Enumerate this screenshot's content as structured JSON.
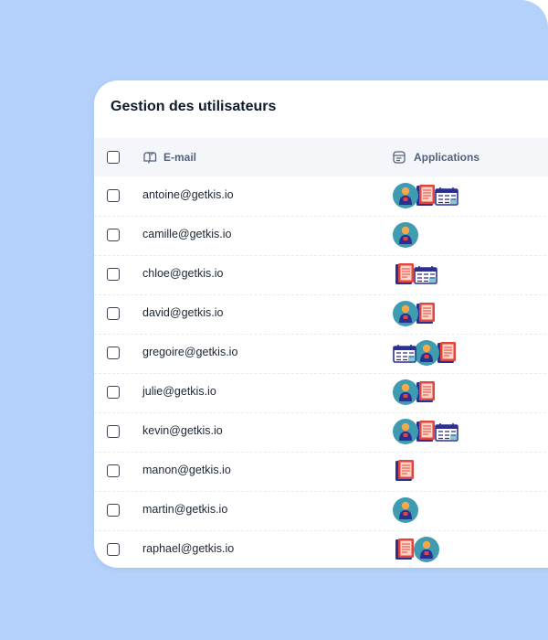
{
  "title": "Gestion des utilisateurs",
  "columns": {
    "email": "E-mail",
    "applications": "Applications"
  },
  "rows": [
    {
      "email": "antoine@getkis.io",
      "apps": [
        "person-app-icon",
        "document-app-icon",
        "calendar-app-icon"
      ]
    },
    {
      "email": "camille@getkis.io",
      "apps": [
        "person-app-icon"
      ]
    },
    {
      "email": "chloe@getkis.io",
      "apps": [
        "document-app-icon",
        "calendar-app-icon"
      ]
    },
    {
      "email": "david@getkis.io",
      "apps": [
        "person-app-icon",
        "document-app-icon"
      ]
    },
    {
      "email": "gregoire@getkis.io",
      "apps": [
        "calendar-app-icon",
        "person-app-icon",
        "document-app-icon"
      ]
    },
    {
      "email": "julie@getkis.io",
      "apps": [
        "person-app-icon",
        "document-app-icon"
      ]
    },
    {
      "email": "kevin@getkis.io",
      "apps": [
        "person-app-icon",
        "document-app-icon",
        "calendar-app-icon"
      ]
    },
    {
      "email": "manon@getkis.io",
      "apps": [
        "document-app-icon"
      ]
    },
    {
      "email": "martin@getkis.io",
      "apps": [
        "person-app-icon"
      ]
    },
    {
      "email": "raphael@getkis.io",
      "apps": [
        "document-app-icon",
        "person-app-icon"
      ]
    }
  ],
  "colors": {
    "background": "#b3d1fb",
    "card": "#ffffff",
    "header_row": "#f4f6f9",
    "title_text": "#0f1b2d",
    "header_text": "#53627a",
    "app_teal": "#3f9bb0",
    "app_navy": "#2b2f8f",
    "app_red": "#e2453e",
    "app_orange": "#f7a94a"
  }
}
